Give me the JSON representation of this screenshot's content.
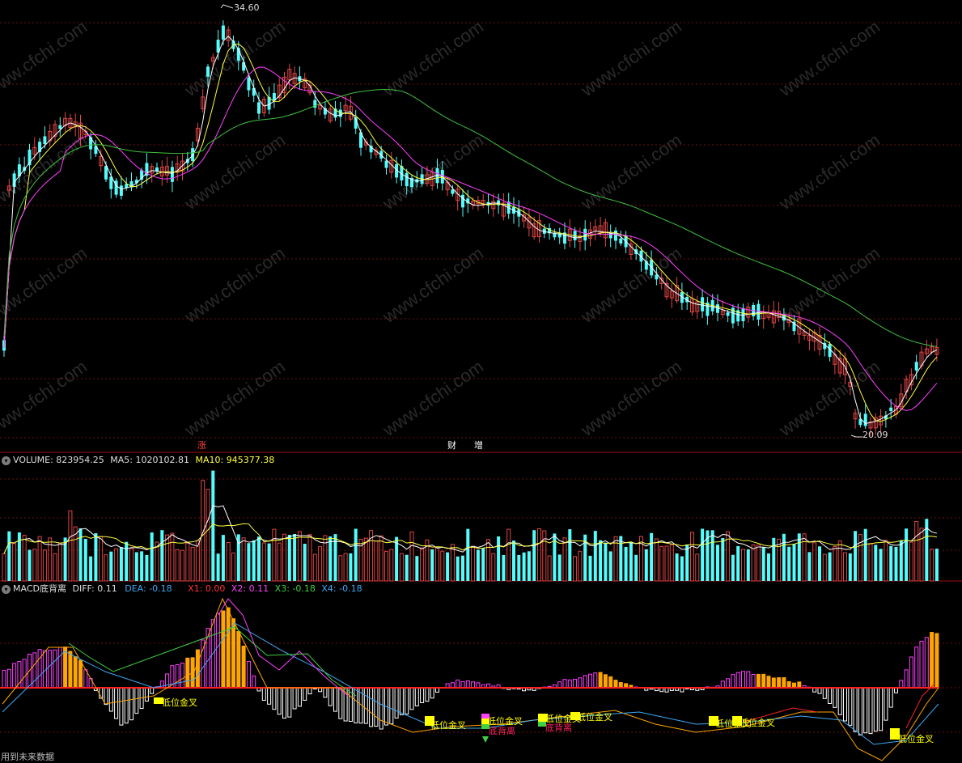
{
  "price_panel": {
    "high_label": "34.60",
    "low_label": "20.09",
    "markers": [
      "涨",
      "财",
      "增"
    ]
  },
  "volume_panel": {
    "title": "VOLUME:",
    "volume": "823954.25",
    "ma5_label": "MA5:",
    "ma5": "1020102.81",
    "ma10_label": "MA10:",
    "ma10": "945377.38"
  },
  "macd_panel": {
    "title": "MACD底背离",
    "diff_label": "DIFF:",
    "diff": "0.11",
    "dea_label": "DEA:",
    "dea": "-0.18",
    "x1_label": "X1:",
    "x1": "0.00",
    "x2_label": "X2:",
    "x2": "0.11",
    "x3_label": "X3:",
    "x3": "-0.18",
    "x4_label": "X4:",
    "x4": "-0.18",
    "signals": [
      "低位金叉",
      "低位金叉",
      "低位金叉",
      "底背离",
      "低位金叉",
      "底背离",
      "低位金叉",
      "低位金叉",
      "低位金叉",
      "低位金叉"
    ]
  },
  "watermark": "www.cfchi.com",
  "footer": "用到未来数据",
  "colors": {
    "up": "#e04545",
    "down": "#54fcfc",
    "ma_white": "#ffffff",
    "ma_yellow": "#ffff40",
    "ma_magenta": "#ff40ff",
    "ma_green": "#40c040",
    "grid": "#8b1a1a",
    "macd_pos_bar": "#ffa500",
    "signal_text": "#ffff00",
    "divergence_text": "#ff2060"
  }
}
